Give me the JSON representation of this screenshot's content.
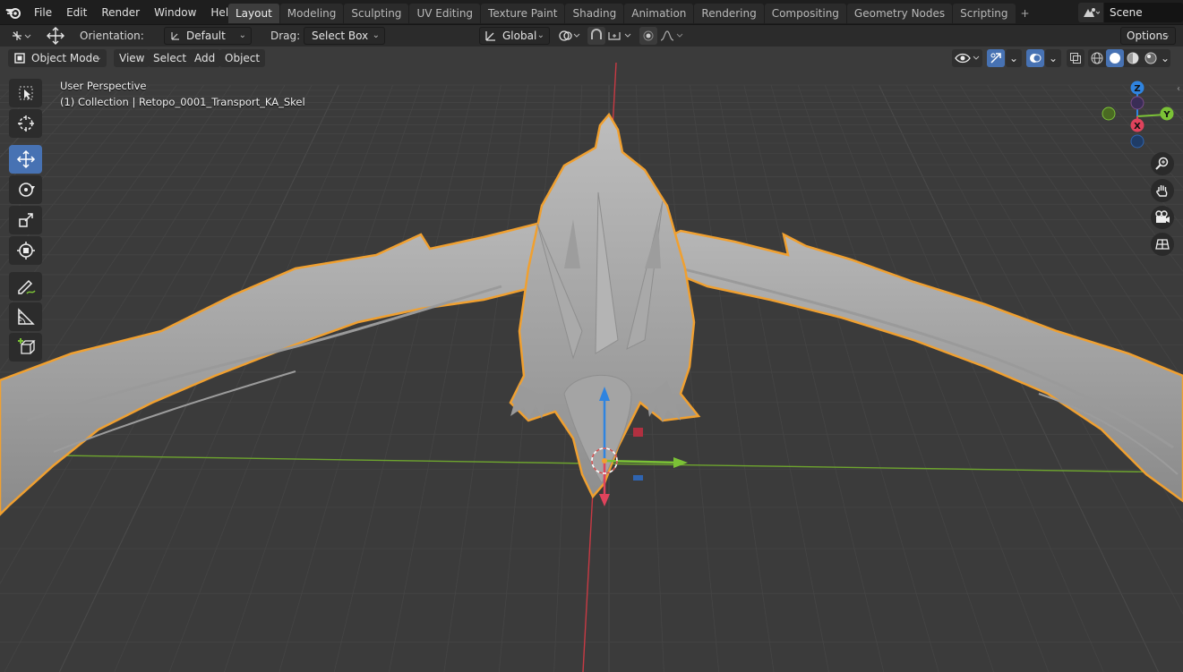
{
  "menu": [
    "File",
    "Edit",
    "Render",
    "Window",
    "Help"
  ],
  "workspaces": [
    "Layout",
    "Modeling",
    "Sculpting",
    "UV Editing",
    "Texture Paint",
    "Shading",
    "Animation",
    "Rendering",
    "Compositing",
    "Geometry Nodes",
    "Scripting"
  ],
  "active_workspace": "Layout",
  "scene": {
    "value": "Scene"
  },
  "tool_settings": {
    "orientation_label": "Orientation:",
    "orientation_value": "Default",
    "drag_label": "Drag:",
    "drag_value": "Select Box",
    "transform_orientation": "Global",
    "options": "Options"
  },
  "header": {
    "mode": "Object Mode",
    "view": "View",
    "select": "Select",
    "add": "Add",
    "object": "Object"
  },
  "viewport": {
    "perspective_label": "User Perspective",
    "collection_label": "(1) Collection | Retopo_0001_Transport_KA_Skel"
  },
  "gizmo": {
    "z": "Z",
    "y": "Y",
    "x": "X"
  },
  "colors": {
    "accent": "#4772b3",
    "selection_outline": "#f0a030",
    "x_axis": "#e0435c",
    "y_axis": "#7bc236",
    "z_axis": "#2f84e0"
  },
  "icons": {
    "logo": "blender-logo-icon",
    "tools": [
      "select-box-icon",
      "cursor-icon",
      "move-icon",
      "rotate-icon",
      "scale-icon",
      "transform-icon",
      "annotate-icon",
      "measure-icon",
      "add-cube-icon"
    ],
    "nav": [
      "zoom-icon",
      "hand-pan-icon",
      "camera-icon",
      "grid-view-icon"
    ]
  }
}
